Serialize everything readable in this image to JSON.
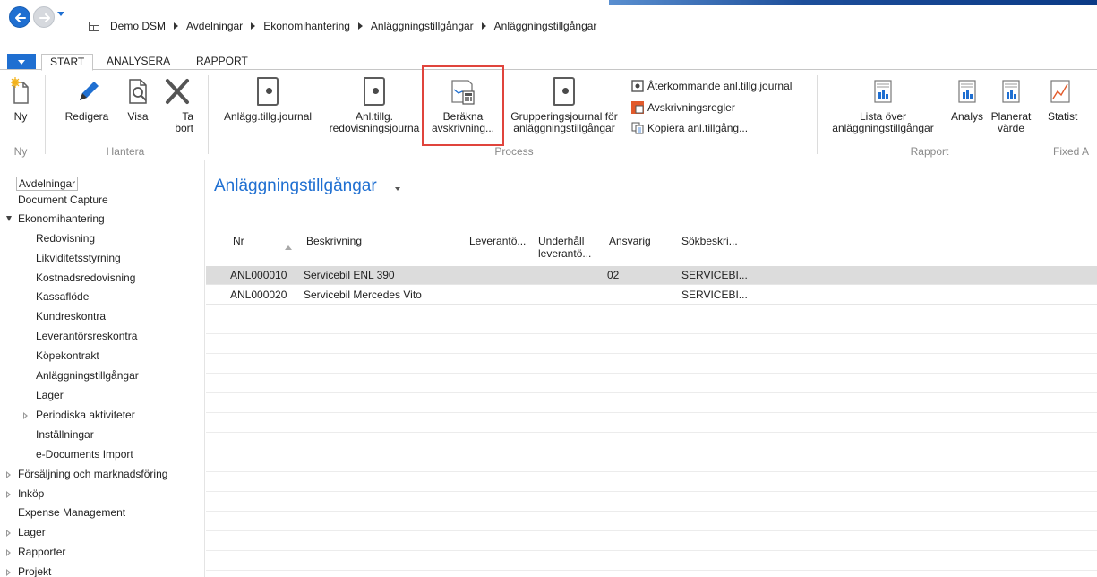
{
  "address_bar": {
    "crumbs": [
      "Demo DSM",
      "Avdelningar",
      "Ekonomihantering",
      "Anläggningstillgångar",
      "Anläggningstillgångar"
    ]
  },
  "ribbon_tabs": [
    "START",
    "ANALYSERA",
    "RAPPORT"
  ],
  "ribbon": {
    "ny": "Ny",
    "redigera": "Redigera",
    "visa": "Visa",
    "ta_bort_1": "Ta",
    "ta_bort_2": "bort",
    "anlagg_journal": "Anlägg.tillg.journal",
    "anl_redov_1": "Anl.tillg.",
    "anl_redov_2": "redovisningsjourna",
    "berakna_1": "Beräkna",
    "berakna_2": "avskrivning...",
    "grupp_1": "Grupperingsjournal för",
    "grupp_2": "anläggningstillgångar",
    "aterkommande": "Återkommande anl.tillg.journal",
    "avskrivningsregler": "Avskrivningsregler",
    "kopiera": "Kopiera anl.tillgång...",
    "lista_1": "Lista över",
    "lista_2": "anläggningstillgångar",
    "analys": "Analys",
    "planerat_1": "Planerat",
    "planerat_2": "värde",
    "statist": "Statist",
    "groups": {
      "ny": "Ny",
      "hantera": "Hantera",
      "process": "Process",
      "rapport": "Rapport",
      "fixed": "Fixed A"
    }
  },
  "nav": {
    "items": [
      "Avdelningar",
      "Document Capture",
      "Ekonomihantering",
      "Redovisning",
      "Likviditetsstyrning",
      "Kostnadsredovisning",
      "Kassaflöde",
      "Kundreskontra",
      "Leverantörsreskontra",
      "Köpekontrakt",
      "Anläggningstillgångar",
      "Lager",
      "Periodiska aktiviteter",
      "Inställningar",
      "e-Documents Import",
      "Försäljning och marknadsföring",
      "Inköp",
      "Expense Management",
      "Lager",
      "Rapporter",
      "Projekt"
    ]
  },
  "page": {
    "title": "Anläggningstillgångar",
    "columns": {
      "nr": "Nr",
      "beskrivning": "Beskrivning",
      "leverantor": "Leverantö...",
      "underhall_1": "Underhåll",
      "underhall_2": "leverantö...",
      "ansvarig": "Ansvarig",
      "sokbeskr": "Sökbeskri..."
    },
    "rows": [
      {
        "nr": "ANL000010",
        "beskrivning": "Servicebil ENL 390",
        "ansvarig": "02",
        "sok": "SERVICEBI..."
      },
      {
        "nr": "ANL000020",
        "beskrivning": "Servicebil Mercedes Vito",
        "ansvarig": "",
        "sok": "SERVICEBI..."
      }
    ]
  },
  "colors": {
    "accent": "#1f6fd1",
    "highlight_box": "#e0443c",
    "selected_row": "#dcdcdc"
  }
}
